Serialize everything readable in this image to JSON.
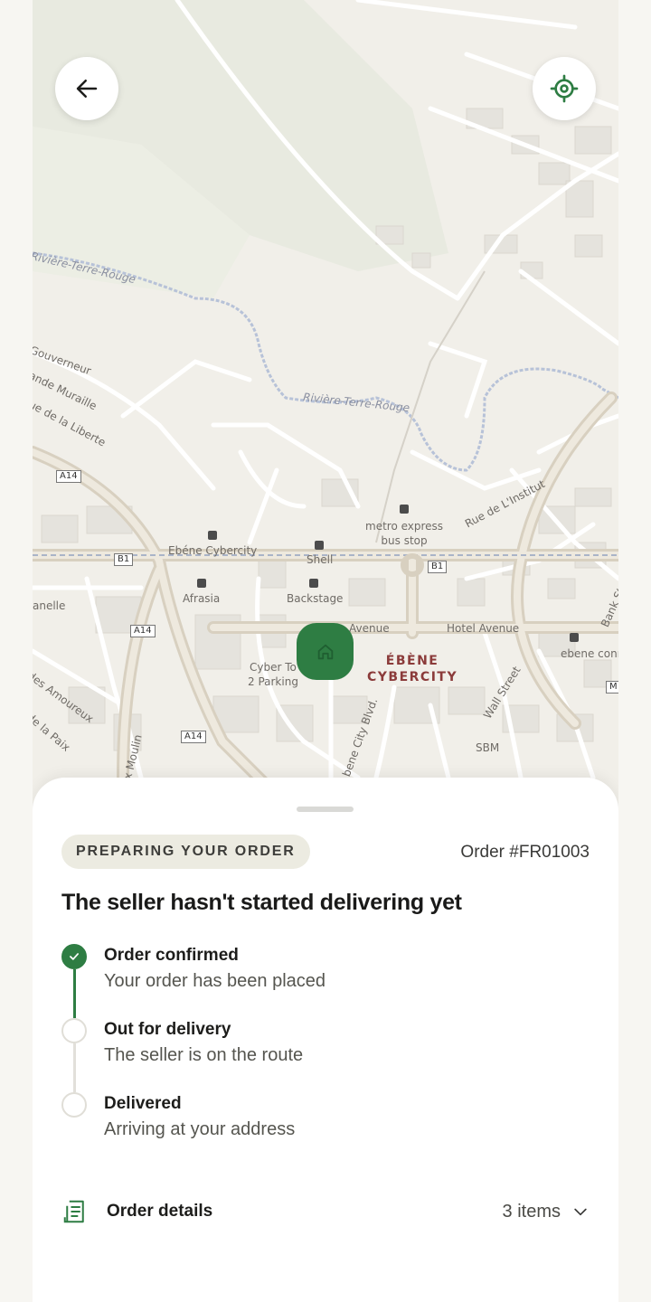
{
  "map": {
    "labels": {
      "river_1": "Rivière-Terre-Rouge",
      "river_2": "Rivière-Terre-Rouge",
      "gouverneur": "Gouverneur",
      "muraille": "ande Muraille",
      "liberte": "ue de la Liberte",
      "a14_top": "A14",
      "a14_mid": "A14",
      "a14_bottom": "A14",
      "b1_left": "B1",
      "b1_right": "B1",
      "ebene_cybercity_stop": "Ebéne Cybercity",
      "shell": "Shell",
      "metro_stop": "metro express\nbus stop",
      "rue_institut": "Rue de L'Institut",
      "afrasia": "Afrasia",
      "backstage": "Backstage",
      "anelle": "anelle",
      "avenue": "Avenue",
      "hotel_avenue": "Hotel Avenue",
      "ebene_connect": "ebene connect",
      "district": "ÉBÈNE\nCYBERCITY",
      "cyber_tower": "Cyber To\n2 Parking",
      "amoureux": "des Amoureux",
      "paix": "de la Paix",
      "moulin": "x Moulin",
      "ebene_blvd": "bene City Blvd.",
      "wall_street": "Wall Street",
      "sbm": "SBM",
      "bank_st": "Bank St",
      "m_shield": "M"
    }
  },
  "header": {
    "back_icon": "arrow-left-icon",
    "locate_icon": "crosshair-icon"
  },
  "pin_icon": "home-icon",
  "accent_color": "#2e7d43",
  "sheet": {
    "status_badge": "PREPARING YOUR ORDER",
    "order_number": "Order #FR01003",
    "headline": "The seller hasn't started delivering yet",
    "steps": [
      {
        "title": "Order confirmed",
        "subtitle": "Your order has been placed",
        "done": true
      },
      {
        "title": "Out for delivery",
        "subtitle": "The seller is on the route",
        "done": false
      },
      {
        "title": "Delivered",
        "subtitle": "Arriving at your address",
        "done": false
      }
    ],
    "details": {
      "label": "Order details",
      "count": "3 items",
      "icon": "receipt-icon",
      "chevron": "chevron-down-icon"
    }
  }
}
